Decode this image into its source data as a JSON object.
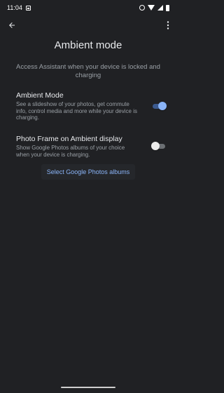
{
  "status_bar": {
    "time": "11:04",
    "icons": [
      "photo-icon",
      "alarm-icon",
      "wifi-icon",
      "signal-icon",
      "battery-charging-icon"
    ]
  },
  "app_bar": {
    "back_icon": "arrow-back-icon",
    "more_icon": "more-vert-icon"
  },
  "page": {
    "title": "Ambient mode",
    "description": "Access Assistant when your device is locked and charging"
  },
  "settings": {
    "ambient_mode": {
      "title": "Ambient Mode",
      "summary": "See a slideshow of your photos, get commute info, control media and more while your device is charging.",
      "enabled": true
    },
    "photo_frame": {
      "title": "Photo Frame on Ambient display",
      "summary": "Show Google Photos albums of your choice when your device is charging.",
      "enabled": false
    }
  },
  "select_albums_label": "Select Google Photos albums",
  "colors": {
    "background": "#202124",
    "accent": "#8ab4f8",
    "text_primary": "#e8eaed",
    "text_secondary": "#9aa0a6"
  }
}
